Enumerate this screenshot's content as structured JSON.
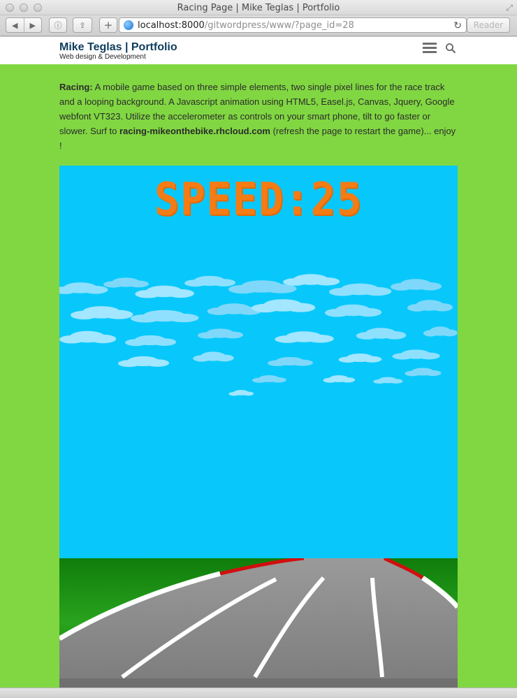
{
  "window": {
    "title": "Racing Page | Mike Teglas | Portfolio"
  },
  "toolbar": {
    "back_glyph": "◀",
    "forward_glyph": "▶",
    "info_glyph": "ⓘ",
    "share_glyph": "⇪",
    "add_glyph": "+",
    "url_host": "localhost:8000",
    "url_path": "/gitwordpress/www/?page_id=28",
    "reload_glyph": "↻",
    "reader_label": "Reader"
  },
  "site": {
    "title": "Mike Teglas | Portfolio",
    "tagline": "Web design & Development"
  },
  "content": {
    "lead": "Racing:",
    "body_1": " A mobile game based on three simple elements, two single pixel lines for the race track and a looping background. A Javascript animation using HTML5, Easel.js, Canvas, Jquery, Google webfont VT323. Utilize the accelerometer as controls on your smart phone, tilt to go faster or slower. Surf to ",
    "link": "racing-mikeonthebike.rhcloud.com",
    "body_2": " (refresh the page to restart the game)... enjoy !"
  },
  "game": {
    "speed_label": "SPEED:",
    "speed_value": "25"
  },
  "icons": [
    "globe-icon",
    "reload-icon",
    "menu-icon",
    "search-icon",
    "back-arrow-icon",
    "forward-arrow-icon",
    "info-icon",
    "share-icon",
    "add-icon"
  ],
  "colors": {
    "page_bg": "#81d742",
    "sky": "#08c8fb",
    "speed_text": "#f47c15",
    "site_title": "#0e3d5c",
    "grass": "#1a8c12",
    "track": "#8a8a8a"
  }
}
